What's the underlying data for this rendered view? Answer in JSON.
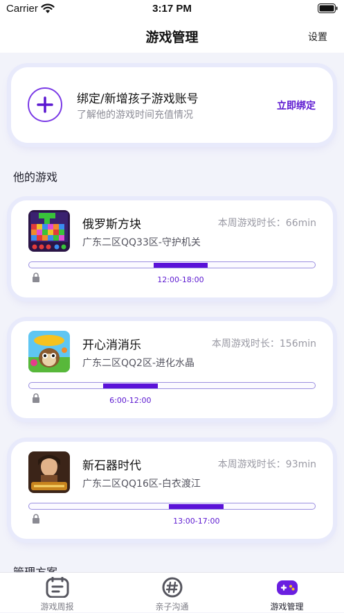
{
  "status_bar": {
    "carrier": "Carrier",
    "time": "3:17 PM"
  },
  "nav": {
    "title": "游戏管理",
    "settings_label": "设置"
  },
  "bind_card": {
    "title": "绑定/新增孩子游戏账号",
    "subtitle": "了解他的游戏时间充值情况",
    "action_label": "立即绑定"
  },
  "games_section_title": "他的游戏",
  "games": [
    {
      "name": "俄罗斯方块",
      "weekly_time": "本周游戏时长：66min",
      "server": "广东二区QQ33区-守护机关",
      "allowed_window": "12:00-18:00",
      "allowed_start_fraction": 0.435,
      "allowed_end_fraction": 0.625,
      "locked": true
    },
    {
      "name": "开心消消乐",
      "weekly_time": "本周游戏时长：156min",
      "server": "广东二区QQ2区-进化水晶",
      "allowed_window": "6:00-12:00",
      "allowed_start_fraction": 0.26,
      "allowed_end_fraction": 0.45,
      "locked": true
    },
    {
      "name": "新石器时代",
      "weekly_time": "本周游戏时长：93min",
      "server": "广东二区QQ16区-白衣渡江",
      "allowed_window": "13:00-17:00",
      "allowed_start_fraction": 0.49,
      "allowed_end_fraction": 0.68,
      "locked": true
    }
  ],
  "next_section_title": "管理方案",
  "tabs": [
    {
      "label": "游戏周报",
      "icon": "report-icon",
      "active": false
    },
    {
      "label": "亲子沟通",
      "icon": "chat-hash-icon",
      "active": false
    },
    {
      "label": "游戏管理",
      "icon": "gamepad-icon",
      "active": true
    }
  ],
  "colors": {
    "accent": "#5A16D0",
    "accent_light": "#7A3AE6",
    "track_border": "#9B8FE0",
    "background": "#F2F3FA"
  }
}
